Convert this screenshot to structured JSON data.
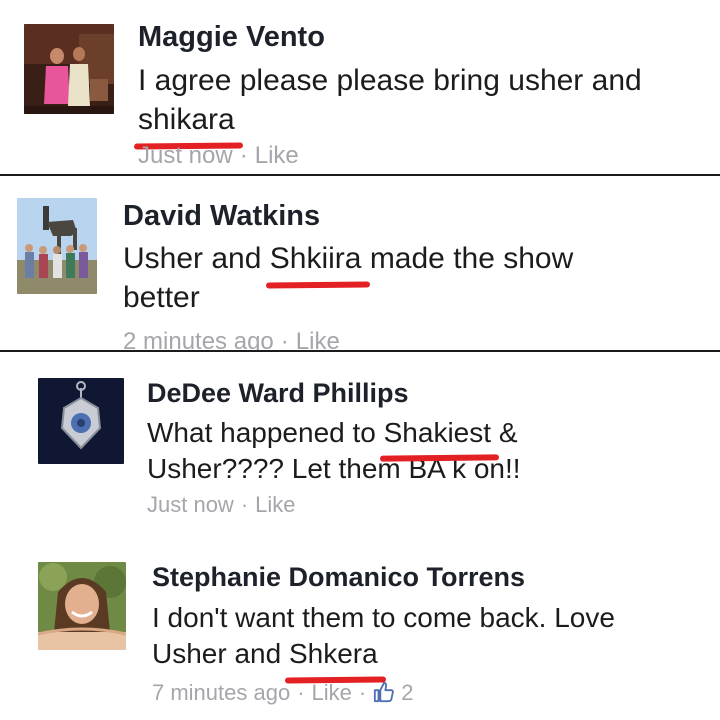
{
  "comments": [
    {
      "author": "Maggie Vento",
      "text_before": "I agree please please bring usher and",
      "highlight": "shikara",
      "text_after": "",
      "time": "Just now",
      "like_label": "Like"
    },
    {
      "author": "David Watkins",
      "text_before": "Usher and",
      "highlight": "Shkiira",
      "text_after": "made the show",
      "text_line2": "better",
      "time": "2 minutes ago",
      "like_label": "Like"
    },
    {
      "author": "DeDee Ward Phillips",
      "text_before": "What happened to",
      "highlight": "Shakiest",
      "text_after": "&",
      "text_line2": "Usher????  Let them BA k on!!",
      "time": "Just now",
      "like_label": "Like"
    },
    {
      "author": "Stephanie Domanico Torrens",
      "text_line1": "I don't want them to come back. Love",
      "text_before": "Usher and",
      "highlight": "Shkera",
      "time": "7 minutes ago",
      "like_label": "Like",
      "like_count": "2"
    }
  ],
  "colors": {
    "underline": "#e32024",
    "meta": "#a4a6ab",
    "thumb": "#4e6fb5"
  },
  "icons": [
    "thumbs-up-icon"
  ]
}
